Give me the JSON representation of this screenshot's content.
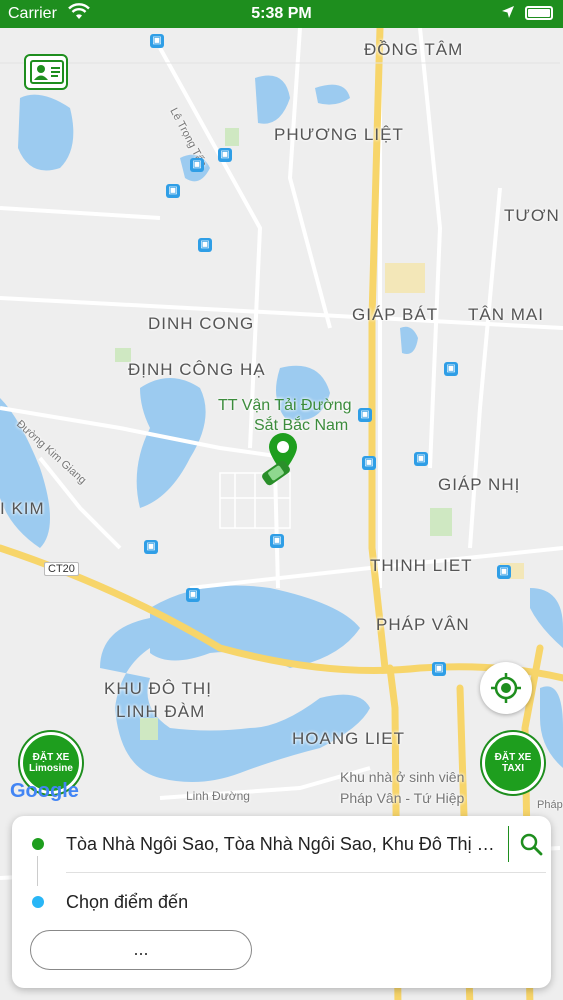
{
  "status_bar": {
    "carrier": "Carrier",
    "time": "5:38 PM"
  },
  "map": {
    "labels": {
      "dong_tam": "ĐỒNG TÂM",
      "phuong_liet": "PHƯƠNG LIỆT",
      "le_trong_tan": "Lê Trọng Tấn",
      "tuong": "TƯƠN",
      "dinh_cong": "DINH CONG",
      "giap_bat": "GIÁP BÁT",
      "tan_mai": "TÂN MAI",
      "dinh_cong_ha": "ĐỊNH CÔNG HẠ",
      "tt_van_tai_1": "TT Vận Tải Đường",
      "tt_van_tai_2": "Sắt Bắc Nam",
      "duong_kim_giang": "Đường Kim Giang",
      "giap_nhi": "GIÁP NHỊ",
      "kim": "I KIM",
      "ct20": "CT20",
      "thinh_liet": "THINH LIET",
      "phap_van": "PHÁP VÂN",
      "kdt_linh_dam_1": "KHU ĐÔ THỊ",
      "kdt_linh_dam_2": "LINH ĐÀM",
      "hoang_liet": "HOANG LIET",
      "khu_nha_1": "Khu nhà ở sinh viên",
      "khu_nha_2": "Pháp Vân - Tứ Hiệp",
      "linh_duong": "Linh Đường",
      "phap_edge": "Pháp"
    },
    "google_logo": "Google"
  },
  "buttons": {
    "limosine_line1": "ĐẶT XE",
    "limosine_line2": "Limosine",
    "taxi_line1": "ĐẶT XE",
    "taxi_line2": "TAXI"
  },
  "booking": {
    "origin": "Tòa Nhà Ngôi Sao, Tòa Nhà Ngôi Sao, Khu Đô Thị Mới Định Công",
    "destination_placeholder": "Chọn điểm đến",
    "more_label": "...",
    "origin_dot_color": "#1e9e1e",
    "destination_dot_color": "#29b6f6"
  },
  "colors": {
    "brand_green": "#1e8e1e",
    "water": "#9ccbf0",
    "road_major": "#f7d56a"
  },
  "icons": [
    "wifi-icon",
    "location-arrow-icon",
    "battery-icon",
    "driver-profile-icon",
    "bus-stop-icon",
    "map-pin-icon",
    "car-icon",
    "locate-icon",
    "search-icon"
  ]
}
